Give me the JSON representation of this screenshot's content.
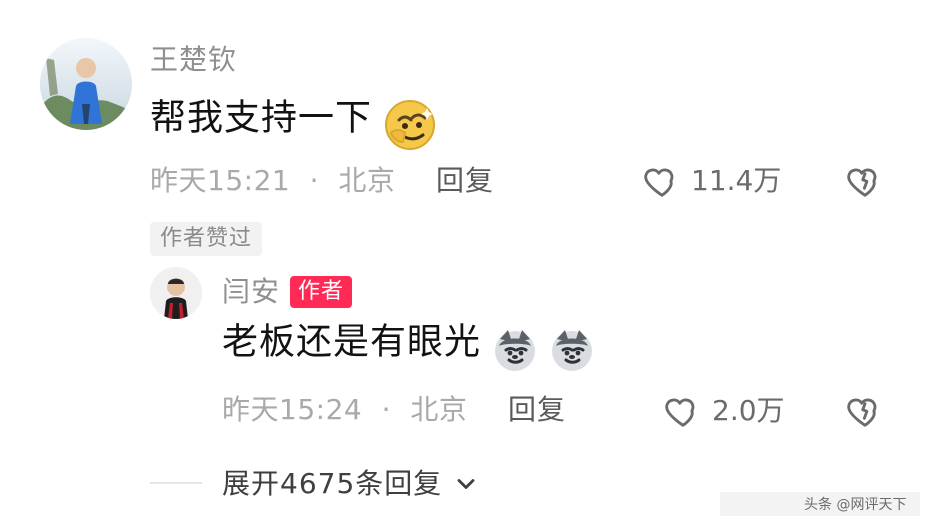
{
  "comments": [
    {
      "author": "王楚钦",
      "text": "帮我支持一下",
      "meta": {
        "time": "昨天15:21",
        "sep": "·",
        "location": "北京"
      },
      "reply_label": "回复",
      "like_count": "11.4万",
      "author_liked_badge": "作者赞过"
    }
  ],
  "replies": [
    {
      "author": "闫安",
      "author_badge": "作者",
      "text": "老板还是有眼光",
      "meta": {
        "time": "昨天15:24",
        "sep": "·",
        "location": "北京"
      },
      "reply_label": "回复",
      "like_count": "2.0万"
    }
  ],
  "expand_label": "展开4675条回复",
  "watermark": "头条 @网评天下"
}
